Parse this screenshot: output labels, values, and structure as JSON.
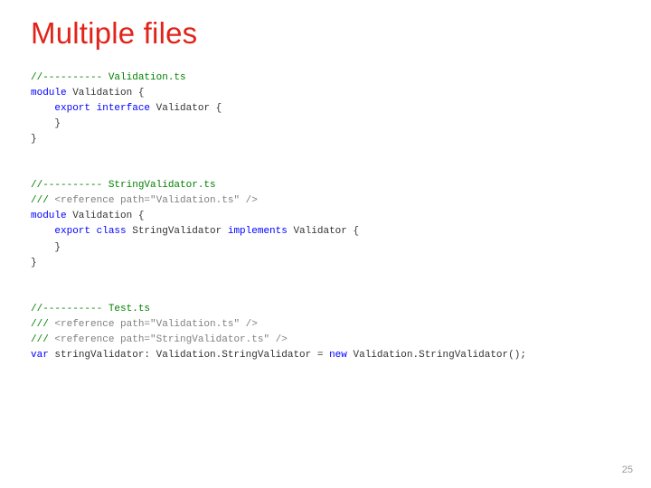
{
  "title": "Multiple files",
  "page_number": "25",
  "code": {
    "b1": {
      "c1": "//---------- Validation.ts",
      "l1a": "module",
      "l1b": " Validation {",
      "l2a": "    export",
      "l2b": " interface",
      "l2c": " Validator {",
      "l3": "    }",
      "l4": "}"
    },
    "b2": {
      "c1": "//---------- StringValidator.ts",
      "r1a": "/// ",
      "r1b": "<reference path=\"Validation.ts\" />",
      "l1a": "module",
      "l1b": " Validation {",
      "l2a": "    export",
      "l2b": " class",
      "l2c": " StringValidator ",
      "l2d": "implements",
      "l2e": " Validator {",
      "l3": "    }",
      "l4": "}"
    },
    "b3": {
      "c1": "//---------- Test.ts",
      "r1a": "/// ",
      "r1b": "<reference path=\"Validation.ts\" />",
      "r2a": "/// ",
      "r2b": "<reference path=\"StringValidator.ts\" />",
      "l1a": "var",
      "l1b": " stringValidator: Validation.StringValidator = ",
      "l1c": "new",
      "l1d": " Validation.StringValidator();"
    }
  }
}
